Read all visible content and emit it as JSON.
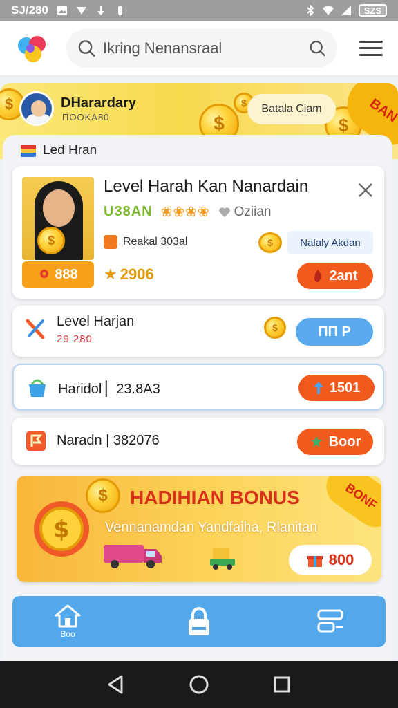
{
  "status_bar": {
    "time": "SJ/280",
    "battery": "SZS"
  },
  "app_bar": {
    "search_placeholder": "Ikring Nenansraal"
  },
  "profile": {
    "name": "DHarardary",
    "subtitle": "ΠΟΟΚΑ80",
    "claim_label": "Batala Ciam",
    "corner_badge": "BAN"
  },
  "section": {
    "title": "Led Hran"
  },
  "featured": {
    "title": "Level Harah Kan Nanardain",
    "code": "U38AN",
    "stars": "❀❀❀❀",
    "likes": "Oziian",
    "reward_label": "Reakal 303al",
    "manage_label": "Nalaly Akdan",
    "price": "888",
    "score": "2906",
    "action_label": "2ant"
  },
  "rows": [
    {
      "label": "Level Harjan",
      "sub": "29 280",
      "action_label": "ΠΠ P"
    },
    {
      "label": "Haridol ▏23.8A3",
      "action_label": "1501"
    },
    {
      "label": "Naradn | 382076",
      "action_label": "Boor"
    }
  ],
  "bonus": {
    "title": "HADIHIAN BONUS",
    "subtitle": "Vennanamdan Yandfaiha, Rlanitan",
    "amount": "800",
    "ribbon": "BONF"
  },
  "tabs": [
    {
      "label": "Boo"
    }
  ],
  "colors": {
    "accent_blue": "#53a8ec",
    "accent_orange": "#f15a1d",
    "gold": "#f7a11b",
    "bonus_red": "#d8311b"
  }
}
